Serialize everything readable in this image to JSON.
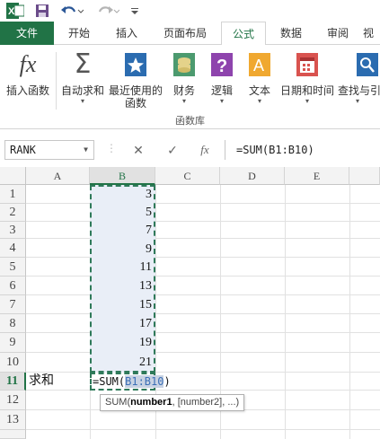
{
  "qat": {
    "icons": [
      "excel-logo-icon",
      "save-icon",
      "undo-icon",
      "redo-icon",
      "customize-icon"
    ]
  },
  "tabs": [
    {
      "label": "文件"
    },
    {
      "label": "开始"
    },
    {
      "label": "插入"
    },
    {
      "label": "页面布局"
    },
    {
      "label": "公式"
    },
    {
      "label": "数据"
    },
    {
      "label": "审阅"
    },
    {
      "label": "视"
    }
  ],
  "ribbon": {
    "buttons": [
      {
        "label": "插入函数",
        "label2": "",
        "has_arrow": false
      },
      {
        "label": "自动求和",
        "label2": "",
        "has_arrow": true
      },
      {
        "label": "最近使用的",
        "label2": "函数",
        "has_arrow": true
      },
      {
        "label": "财务",
        "label2": "",
        "has_arrow": true
      },
      {
        "label": "逻辑",
        "label2": "",
        "has_arrow": true
      },
      {
        "label": "文本",
        "label2": "",
        "has_arrow": true
      },
      {
        "label": "日期和时间",
        "label2": "",
        "has_arrow": true
      },
      {
        "label": "查找与引",
        "label2": "",
        "has_arrow": true
      }
    ],
    "group_label": "函数库"
  },
  "formula_bar": {
    "name_box": "RANK",
    "fx_label": "fx",
    "formula": "=SUM(B1:B10)"
  },
  "grid": {
    "columns": [
      "A",
      "B",
      "C",
      "D",
      "E"
    ],
    "rows": [
      "1",
      "2",
      "3",
      "4",
      "5",
      "6",
      "7",
      "8",
      "9",
      "10",
      "11",
      "12",
      "13"
    ],
    "b_values": [
      "3",
      "5",
      "7",
      "9",
      "11",
      "13",
      "15",
      "17",
      "19",
      "21"
    ],
    "a11": "求和",
    "b11_prefix": "=SUM(",
    "b11_ref": "B1:B10",
    "b11_suffix": ")",
    "tooltip_prefix": "SUM(",
    "tooltip_bold": "number1",
    "tooltip_rest": ", [number2], ...)"
  },
  "colors": {
    "accent": "#217346",
    "range_fill": "#e9eef7",
    "ref_blue": "#3b6fb6"
  }
}
